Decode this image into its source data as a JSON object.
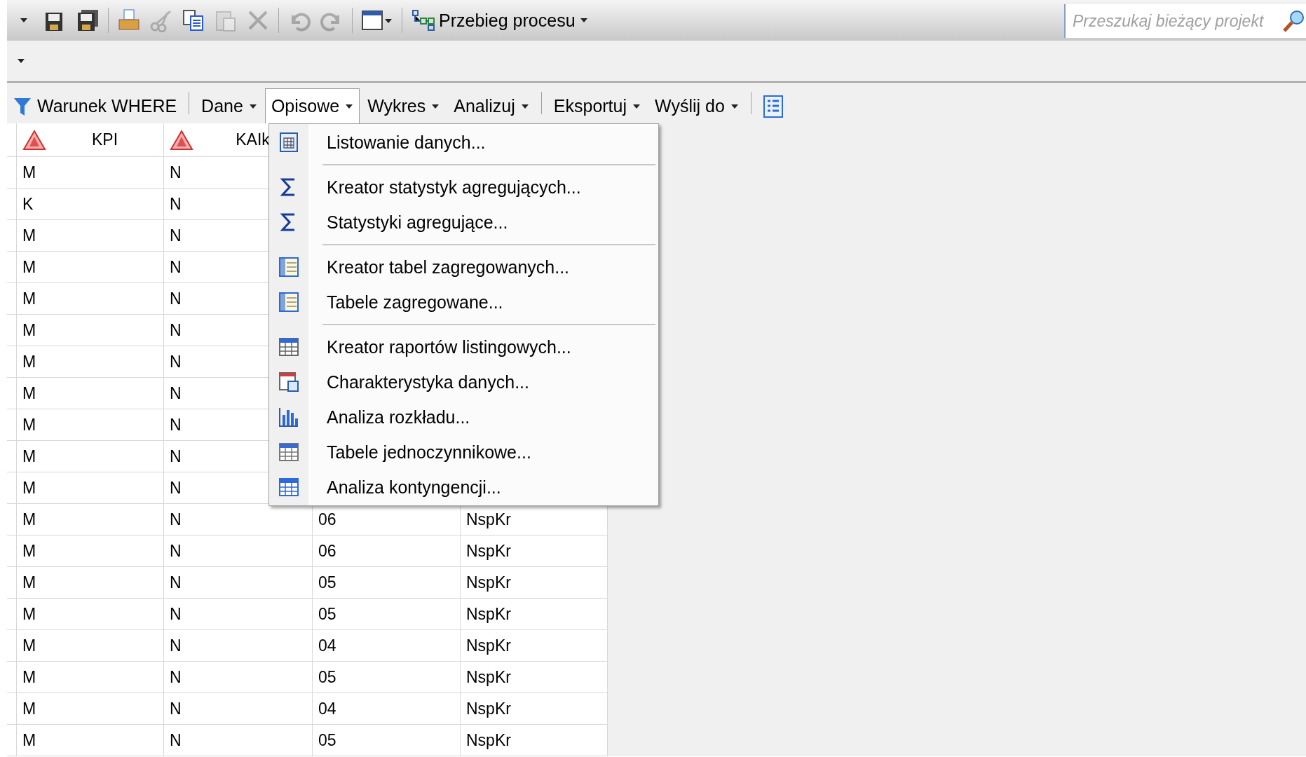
{
  "toolbar": {
    "buttons": [
      {
        "disabled": false
      },
      {
        "disabled": false
      },
      {
        "disabled": false
      },
      {
        "disabled": false
      },
      {
        "disabled": true
      },
      {
        "disabled": false
      },
      {
        "disabled": true
      },
      {
        "disabled": true
      },
      {
        "disabled": true
      },
      {
        "disabled": true
      },
      {
        "disabled": false
      }
    ],
    "process_flow": {
      "label": "Przebieg procesu"
    }
  },
  "search": {
    "placeholder": "Przeszukaj bieżący projekt"
  },
  "data_toolbar": {
    "items": [
      {
        "kind": "button",
        "label": "Warunek WHERE"
      },
      {
        "kind": "separator"
      },
      {
        "kind": "menu",
        "label": "Dane",
        "selected": false
      },
      {
        "kind": "menu",
        "label": "Opisowe",
        "selected": true
      },
      {
        "kind": "menu",
        "label": "Wykres",
        "selected": false
      },
      {
        "kind": "menu",
        "label": "Analizuj",
        "selected": false
      },
      {
        "kind": "separator"
      },
      {
        "kind": "menu",
        "label": "Eksportuj",
        "selected": false
      },
      {
        "kind": "menu",
        "label": "Wyślij do",
        "selected": false
      },
      {
        "kind": "separator"
      },
      {
        "kind": "icon-button"
      }
    ]
  },
  "menu": {
    "items": [
      {
        "kind": "item",
        "label": "Listowanie danych..."
      },
      {
        "kind": "separator"
      },
      {
        "kind": "item",
        "label": "Kreator statystyk agregujących..."
      },
      {
        "kind": "item",
        "label": "Statystyki agregujące..."
      },
      {
        "kind": "separator"
      },
      {
        "kind": "item",
        "label": "Kreator tabel zagregowanych..."
      },
      {
        "kind": "item",
        "label": "Tabele zagregowane..."
      },
      {
        "kind": "separator"
      },
      {
        "kind": "item",
        "label": "Kreator raportów listingowych..."
      },
      {
        "kind": "item",
        "label": "Charakterystyka danych..."
      },
      {
        "kind": "item",
        "label": "Analiza rozkładu..."
      },
      {
        "kind": "item",
        "label": "Tabele jednoczynnikowe..."
      },
      {
        "kind": "item",
        "label": "Analiza kontyngencji..."
      }
    ]
  },
  "table": {
    "columns": [
      {
        "label": "KPI"
      },
      {
        "label": "KAIk"
      }
    ],
    "rows": [
      {
        "cells": [
          "M",
          "N"
        ]
      },
      {
        "cells": [
          "K",
          "N"
        ]
      },
      {
        "cells": [
          "M",
          "N"
        ]
      },
      {
        "cells": [
          "M",
          "N"
        ]
      },
      {
        "cells": [
          "M",
          "N"
        ]
      },
      {
        "cells": [
          "M",
          "N"
        ]
      },
      {
        "cells": [
          "M",
          "N"
        ]
      },
      {
        "cells": [
          "M",
          "N"
        ]
      },
      {
        "cells": [
          "M",
          "N"
        ]
      },
      {
        "cells": [
          "M",
          "N"
        ]
      },
      {
        "cells": [
          "M",
          "N"
        ]
      },
      {
        "cells": [
          "M",
          "N",
          "06",
          "NspKr"
        ]
      },
      {
        "cells": [
          "M",
          "N",
          "06",
          "NspKr"
        ]
      },
      {
        "cells": [
          "M",
          "N",
          "05",
          "NspKr"
        ]
      },
      {
        "cells": [
          "M",
          "N",
          "05",
          "NspKr"
        ]
      },
      {
        "cells": [
          "M",
          "N",
          "04",
          "NspKr"
        ]
      },
      {
        "cells": [
          "M",
          "N",
          "05",
          "NspKr"
        ]
      },
      {
        "cells": [
          "M",
          "N",
          "04",
          "NspKr"
        ]
      },
      {
        "cells": [
          "M",
          "N",
          "05",
          "NspKr"
        ]
      }
    ]
  }
}
